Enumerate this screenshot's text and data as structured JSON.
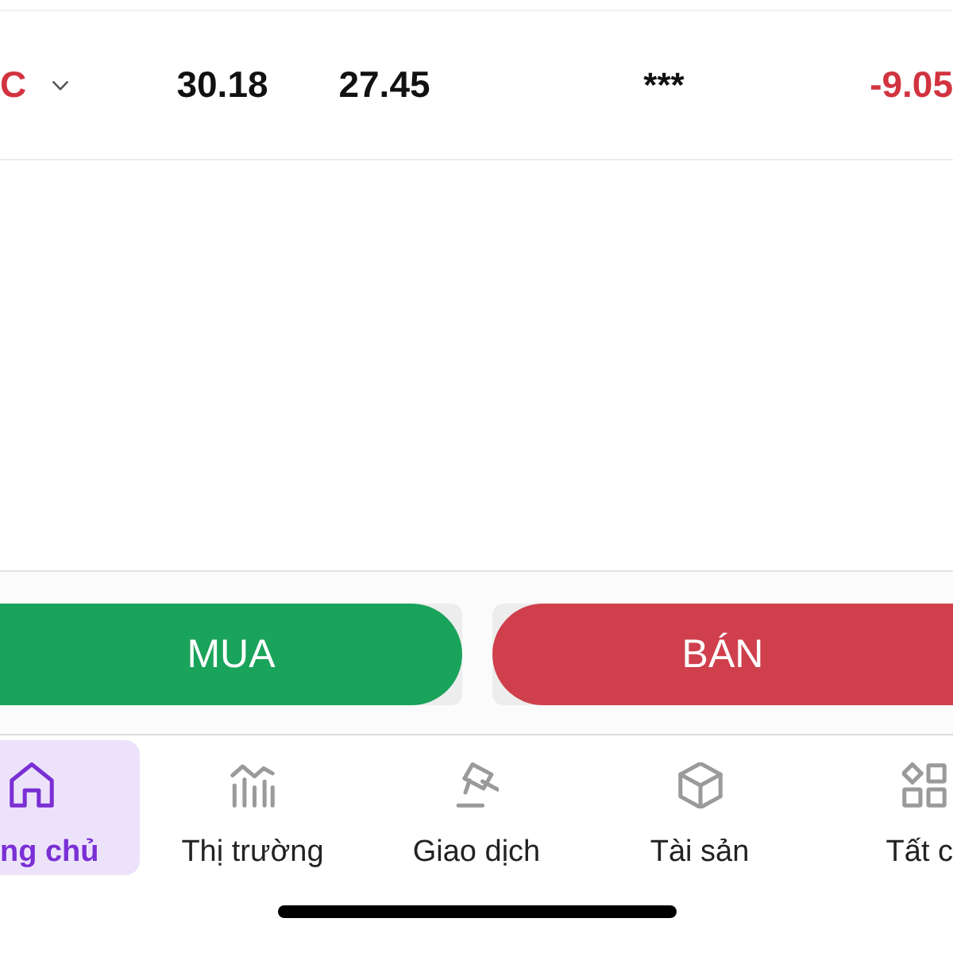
{
  "quote_row": {
    "cells": [
      {
        "text": "C",
        "color": "#d1343f"
      },
      {
        "text": "30.18",
        "color": "#111111"
      },
      {
        "text": "27.45",
        "color": "#111111"
      },
      {
        "text": "***",
        "color": "#111111"
      },
      {
        "text": "-9.05",
        "color": "#d1343f"
      }
    ]
  },
  "actions": [
    {
      "label": "MUA",
      "kind": "buy"
    },
    {
      "label": "BÁN",
      "kind": "sell"
    }
  ],
  "tab_bar": [
    {
      "label": "ng chủ",
      "kind": "home",
      "selected": true
    },
    {
      "label": "Thị trường",
      "kind": "market",
      "selected": false
    },
    {
      "label": "Giao dịch",
      "kind": "trade",
      "selected": false
    },
    {
      "label": "Tài sản",
      "kind": "assets",
      "selected": false
    },
    {
      "label": "Tất c",
      "kind": "all",
      "selected": false
    }
  ]
}
